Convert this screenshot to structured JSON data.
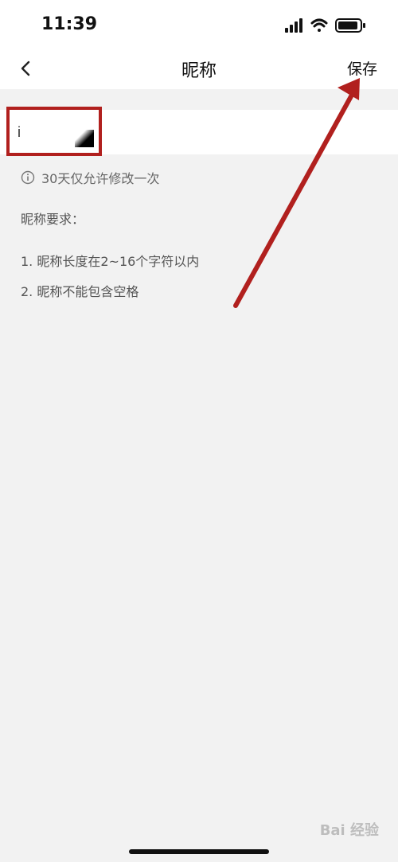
{
  "status_bar": {
    "time": "11:39"
  },
  "nav": {
    "back_icon": "chevron-left-icon",
    "title": "昵称",
    "save_label": "保存"
  },
  "input": {
    "value": "i"
  },
  "notice": {
    "icon": "info-icon",
    "text": "30天仅允许修改一次"
  },
  "requirements": {
    "title": "昵称要求：",
    "items": [
      "1. 昵称长度在2~16个字符以内",
      "2. 昵称不能包含空格"
    ]
  },
  "annotation": {
    "color": "#b1201e"
  },
  "watermark": {
    "text": "Bai 经验"
  }
}
